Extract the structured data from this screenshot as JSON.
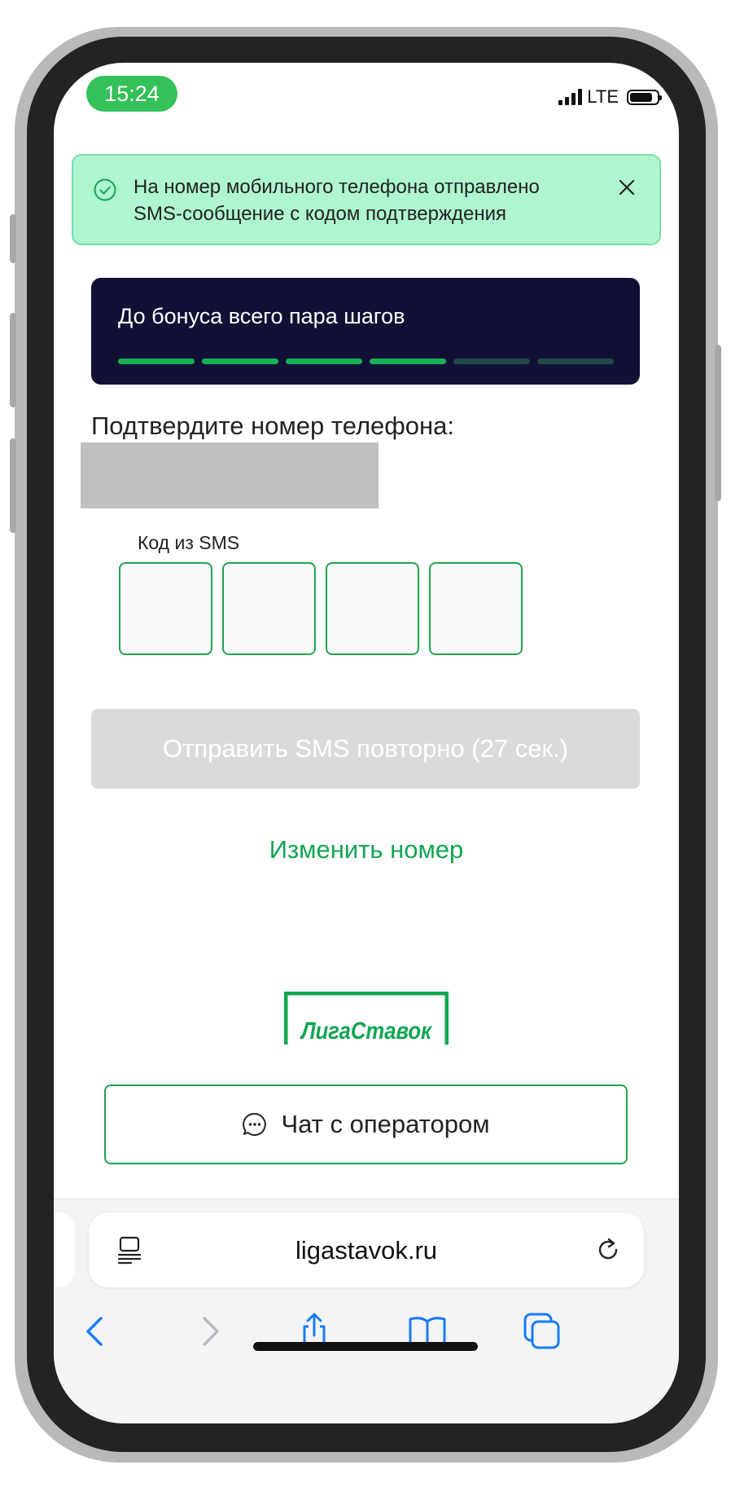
{
  "status_bar": {
    "time": "15:24",
    "network": "LTE"
  },
  "toast": {
    "message": "На номер мобильного телефона отправлено SMS-сообщение с кодом подтверждения"
  },
  "bonus_banner": {
    "title": "До бонуса всего пара шагов",
    "steps_completed": 4,
    "steps_total": 6
  },
  "verification": {
    "title": "Подтвердите номер телефона:",
    "code_label": "Код из SMS",
    "code_digits": [
      "",
      "",
      "",
      ""
    ],
    "resend_button": "Отправить SMS повторно (27 сек.)",
    "change_number_link": "Изменить номер"
  },
  "logo": {
    "text": "ЛигаСтавок"
  },
  "chat_button": {
    "label": "Чат с оператором"
  },
  "browser": {
    "url": "ligastavok.ru"
  },
  "colors": {
    "brand_green": "#12a552",
    "toast_bg": "#aef5d0",
    "banner_bg": "#121135",
    "step_done": "#19b055",
    "step_todo": "#1f4a45",
    "ios_blue": "#1a7bf5"
  }
}
